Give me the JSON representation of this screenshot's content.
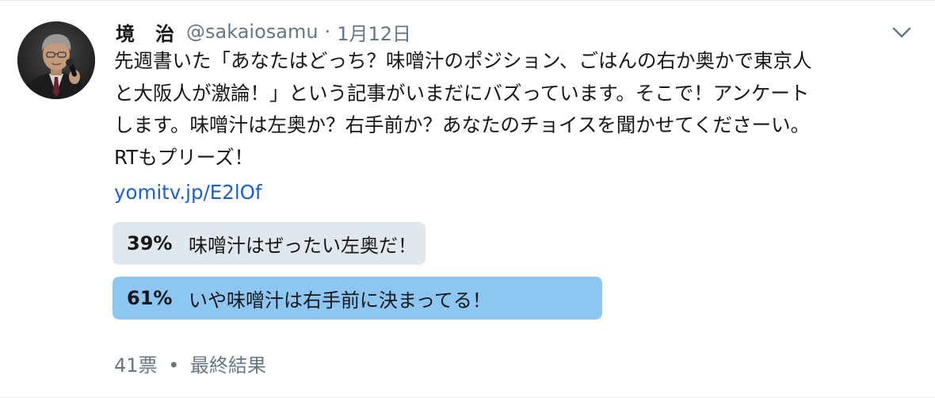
{
  "tweet": {
    "author": {
      "display_name": "境　治",
      "handle": "@sakaiosamu",
      "avatar_icon": "person-photo-avatar"
    },
    "separator": "·",
    "timestamp": "1月12日",
    "text_lines": [
      "先週書いた「あなたはどっち？味噌汁のポジション、ごはんの右か奥かで東京人",
      "と大阪人が激論！」という記事がいまだにバズっています。そこで！アンケート",
      "します。味噌汁は左奥か？右手前か？あなたのチョイスを聞かせてくださーい。",
      "RTもプリーズ！"
    ],
    "link_text": "yomitv.jp/E2lOf",
    "menu_icon": "chevron-down-icon"
  },
  "poll": {
    "options": [
      {
        "percent": "39%",
        "label": "味噌汁はぜったい左奥だ！",
        "share": 0.39,
        "color": "#e1e8ed",
        "winner": false
      },
      {
        "percent": "61%",
        "label": "いや味噌汁は右手前に決まってる！",
        "share": 0.61,
        "color": "#8ec6f2",
        "winner": true
      }
    ],
    "votes": "41票",
    "separator": "•",
    "status": "最終結果"
  },
  "colors": {
    "text": "#14171a",
    "secondary": "#657786",
    "link": "#1b5fd4",
    "poll_loser": "#e1e8ed",
    "poll_winner": "#8ec6f2"
  }
}
